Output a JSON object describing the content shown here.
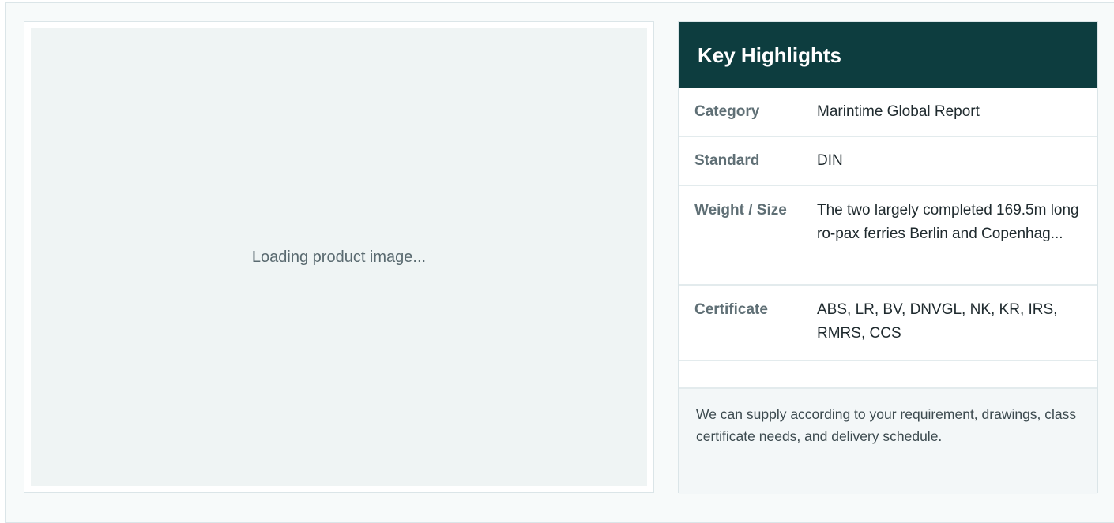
{
  "image_panel": {
    "loading_text": "Loading product image..."
  },
  "highlights": {
    "title": "Key Highlights",
    "rows": [
      {
        "label": "Category",
        "value": "Marintime Global Report"
      },
      {
        "label": "Standard",
        "value": "DIN"
      },
      {
        "label": "Weight / Size",
        "value": "The two largely completed 169.5m long ro-pax ferries Berlin and Copenhag..."
      },
      {
        "label": "Certificate",
        "value": "ABS, LR, BV, DNVGL, NK, KR, IRS, RMRS, CCS"
      }
    ],
    "note": "We can supply according to your requirement, drawings, class certificate needs, and delivery schedule."
  },
  "colors": {
    "header_bg": "#0d3d3f",
    "label_text": "#5f6f75",
    "image_placeholder_bg": "#eff4f4"
  }
}
